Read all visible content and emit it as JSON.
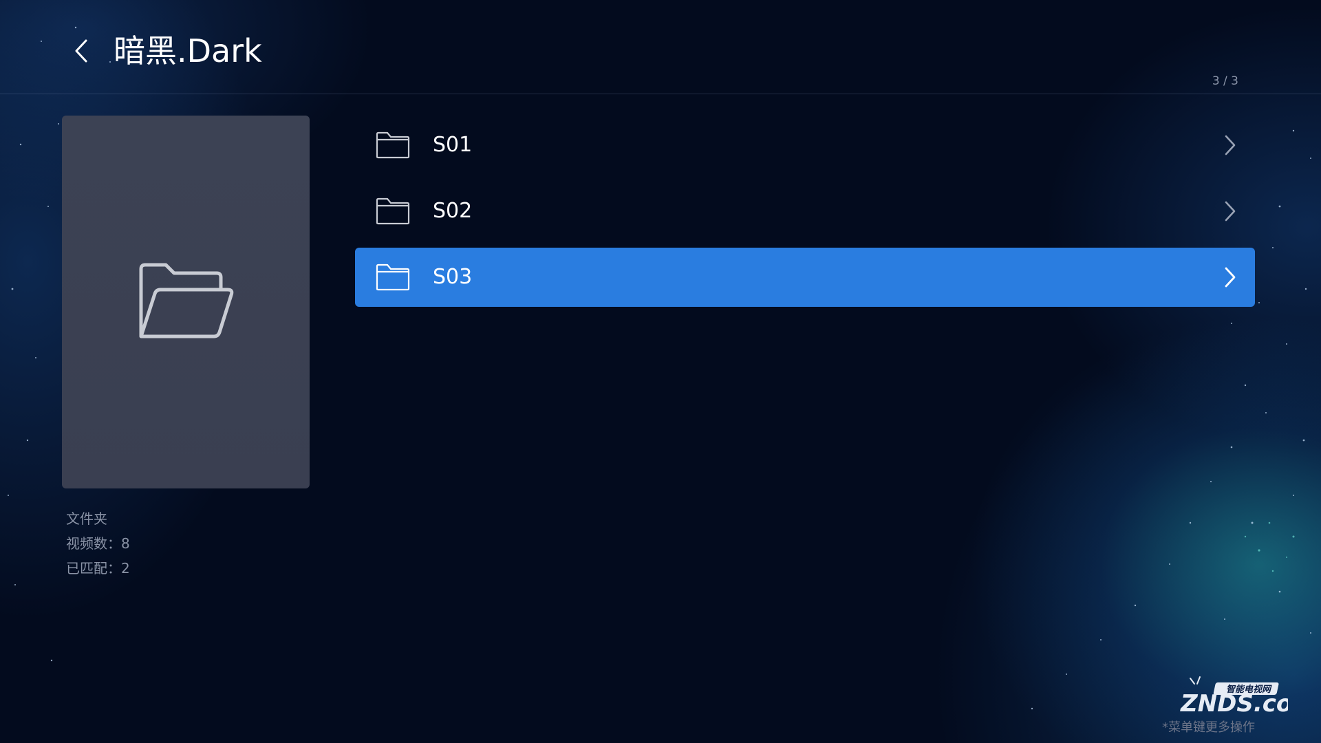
{
  "header": {
    "back_icon": "chevron-left-icon",
    "title": "暗黑.Dark",
    "page_indicator": "3 / 3"
  },
  "preview": {
    "icon": "folder-open-icon",
    "type_label": "文件夹",
    "video_count_label": "视频数：",
    "video_count_value": "8",
    "matched_label": "已匹配：",
    "matched_value": "2"
  },
  "folders": [
    {
      "label": "S01",
      "icon": "folder-icon",
      "selected": false
    },
    {
      "label": "S02",
      "icon": "folder-icon",
      "selected": false
    },
    {
      "label": "S03",
      "icon": "folder-icon",
      "selected": true
    }
  ],
  "footer": {
    "logo_text": "ZNDS.com",
    "logo_subtitle": "智能电视网",
    "hint": "*菜单键更多操作"
  },
  "colors": {
    "background": "#030b1e",
    "selected_row": "#2a7de0",
    "preview_card": "#3c4254",
    "muted_text": "#8a93a6"
  }
}
